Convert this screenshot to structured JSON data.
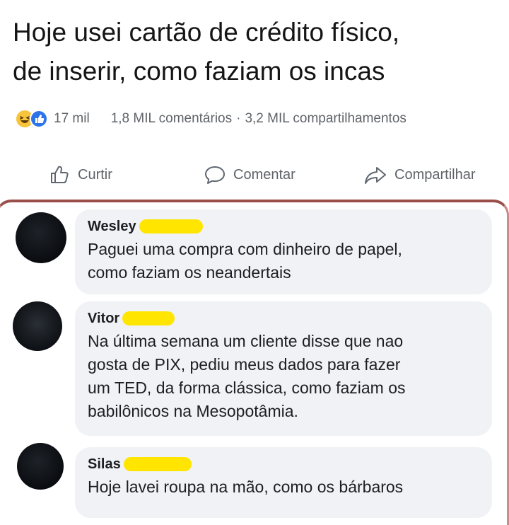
{
  "post": {
    "text_line1": "Hoje usei cartão de crédito físico,",
    "text_line2": "de inserir, como faziam os incas"
  },
  "stats": {
    "reactions_count": "17 mil",
    "comments": "1,8 MIL comentários",
    "separator": "·",
    "shares": "3,2 MIL compartilhamentos",
    "reaction_icons": [
      "haha-emoji-icon",
      "like-reaction-icon"
    ]
  },
  "actions": {
    "like": "Curtir",
    "comment": "Comentar",
    "share": "Compartilhar"
  },
  "comments": [
    {
      "author": "Wesley",
      "lines": [
        "Paguei uma compra com dinheiro de papel,",
        "como faziam os neandertais"
      ]
    },
    {
      "author": "Vitor",
      "lines": [
        "Na última semana um cliente disse que nao",
        "gosta de PIX, pediu meus dados para fazer",
        "um TED, da forma clássica, como faziam os",
        "babilônicos na Mesopotâmia."
      ]
    },
    {
      "author": "Silas",
      "lines": [
        "Hoje lavei roupa na mão, como os bárbaros"
      ]
    }
  ],
  "colors": {
    "bubble_bg": "#f0f2f5",
    "redaction": "#ffe500",
    "secondary_text": "#5f6368",
    "divider": "#9a4f4a"
  }
}
